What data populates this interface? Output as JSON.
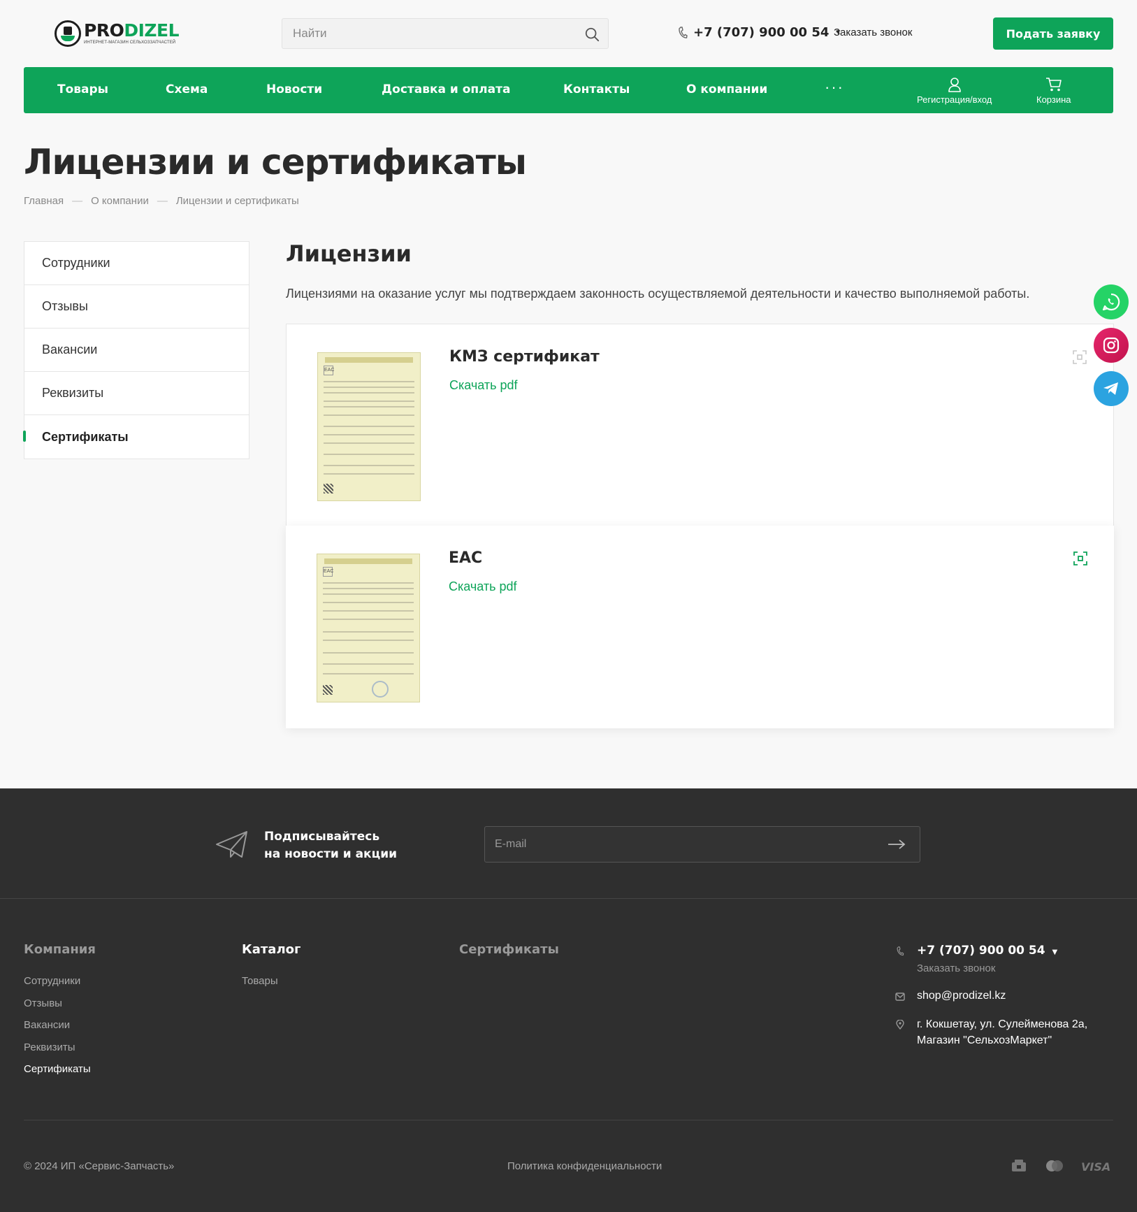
{
  "header": {
    "logo_name_a": "PRO",
    "logo_name_b": "DIZEL",
    "logo_subtitle": "ИНТЕРНЕТ-МАГАЗИН СЕЛЬХОЗЗАПЧАСТЕЙ",
    "search_placeholder": "Найти",
    "phone": "+7 (707) 900 00 54",
    "callback": "Заказать звонок",
    "apply_button": "Подать заявку"
  },
  "nav": {
    "items": [
      "Товары",
      "Схема",
      "Новости",
      "Доставка и оплата",
      "Контакты",
      "О компании"
    ],
    "more": "···",
    "account": "Регистрация/вход",
    "cart": "Корзина"
  },
  "page": {
    "title": "Лицензии и сертификаты",
    "breadcrumb": [
      "Главная",
      "О компании",
      "Лицензии и сертификаты"
    ],
    "breadcrumb_sep": "—"
  },
  "sidebar": {
    "items": [
      "Сотрудники",
      "Отзывы",
      "Вакансии",
      "Реквизиты",
      "Сертификаты"
    ],
    "active_index": 4
  },
  "content": {
    "section_title": "Лицензии",
    "description": "Лицензиями на оказание услуг мы подтверждаем законность осуществляемой деятельности и качество выполняемой работы.",
    "cards": [
      {
        "title": "КМЗ сертификат",
        "link": "Скачать pdf"
      },
      {
        "title": "EAC",
        "link": "Скачать pdf"
      }
    ]
  },
  "subscribe": {
    "line1": "Подписывайтесь",
    "line2": "на новости и акции",
    "email_placeholder": "E-mail"
  },
  "footer": {
    "col_company": "Компания",
    "company_links": [
      "Сотрудники",
      "Отзывы",
      "Вакансии",
      "Реквизиты",
      "Сертификаты"
    ],
    "col_catalog": "Каталог",
    "catalog_links": [
      "Товары"
    ],
    "col_certs": "Сертификаты",
    "phone": "+7 (707) 900 00 54",
    "callback": "Заказать звонок",
    "email": "shop@prodizel.kz",
    "address_line1": "г. Кокшетау, ул. Сулейменова 2а,",
    "address_line2": "Магазин \"СельхозМаркет\"",
    "copyright": "© 2024 ИП «Сервис-Запчасть»",
    "policy": "Политика конфиденциальности",
    "visa": "VISA"
  },
  "colors": {
    "accent": "#0ea459",
    "footer_bg": "#2f2f2f",
    "whatsapp": "#25d366",
    "instagram": "#e6266b",
    "telegram": "#2ba3e0"
  }
}
